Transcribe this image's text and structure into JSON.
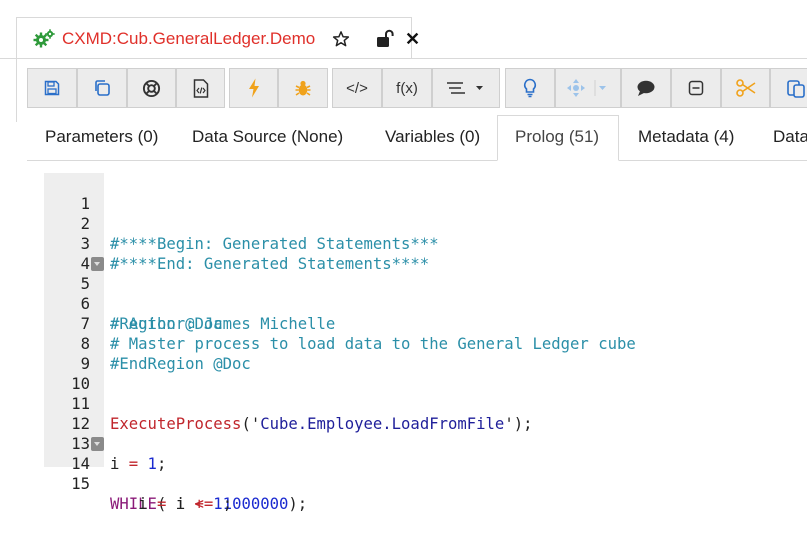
{
  "document_tab": {
    "title": "CXMD:Cub.GeneralLedger.Demo",
    "icons": [
      "gears-icon",
      "star-icon",
      "unlock-icon",
      "close-icon"
    ],
    "close_glyph": "✕"
  },
  "toolbar": {
    "fx_label": "f(x)",
    "code_label": "</>",
    "buttons": [
      "save-icon",
      "copy-icon",
      "lifebuoy-icon",
      "code-file-icon",
      "bolt-icon",
      "bug-icon",
      "code-icon",
      "function",
      "indent-icon",
      "lightbulb-icon",
      "move-icon",
      "comment-icon",
      "collapse-icon",
      "scissors-icon",
      "paste-icon"
    ]
  },
  "subtabs": [
    {
      "label": "Parameters (0)"
    },
    {
      "label": "Data Source  (None)"
    },
    {
      "label": "Variables (0)"
    },
    {
      "label": "Prolog (51)",
      "active": true
    },
    {
      "label": "Metadata (4)"
    },
    {
      "label": "Data"
    }
  ],
  "editor": {
    "lines": [
      {
        "n": "1",
        "text": ""
      },
      {
        "n": "2",
        "text": "#****Begin: Generated Statements***"
      },
      {
        "n": "3",
        "text": "#****End: Generated Statements****"
      },
      {
        "n": "4",
        "text": ""
      },
      {
        "n": "5",
        "text": "#Region @Doc",
        "fold": true
      },
      {
        "n": "6",
        "text": "# Author: James Michelle"
      },
      {
        "n": "7",
        "text": "# Master process to load data to the General Ledger cube"
      },
      {
        "n": "8",
        "text": "#EndRegion @Doc"
      },
      {
        "n": "9",
        "text": ""
      },
      {
        "n": "10",
        "text": ""
      },
      {
        "n": "11",
        "t1": "ExecuteProcess",
        "t2": "('",
        "t3": "Cube.Employee.LoadFromFile",
        "t4": "');"
      },
      {
        "n": "12",
        "text": ""
      },
      {
        "n": "13",
        "t1": "i ",
        "t2": "=",
        "t3": " 1",
        "t4": ";"
      },
      {
        "n": "14",
        "fold": true,
        "t1": "WHILE",
        "t2": "( i ",
        "t3": "<=",
        "t4": " 1000000",
        "t5": ");"
      },
      {
        "n": "15",
        "t1": "   i ",
        "t2": "=",
        "t3": " i ",
        "t4": "+",
        "t5": " 1",
        "t6": ";"
      }
    ]
  },
  "colors": {
    "title_red": "#e0302a",
    "comment": "#2b8fa8",
    "keyword": "#8b1a78",
    "function": "#c0262c",
    "string": "#1f1f9a",
    "number": "#1a2ad0"
  }
}
